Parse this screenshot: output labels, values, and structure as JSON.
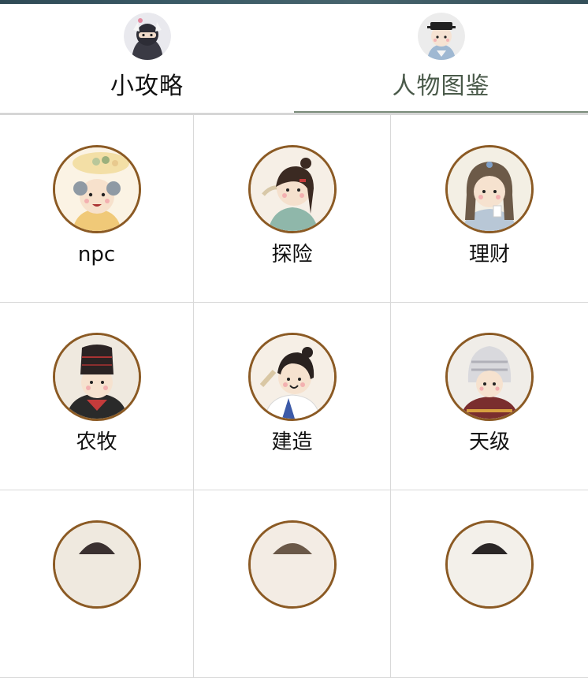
{
  "tabs": [
    {
      "label": "小攻略",
      "active": false,
      "icon": "ninja-avatar-icon"
    },
    {
      "label": "人物图鉴",
      "active": true,
      "icon": "official-avatar-icon"
    }
  ],
  "categories": [
    {
      "label": "npc",
      "icon": "elder-avatar-icon"
    },
    {
      "label": "探险",
      "icon": "adventurer-avatar-icon"
    },
    {
      "label": "理财",
      "icon": "lady-avatar-icon"
    },
    {
      "label": "农牧",
      "icon": "farmer-avatar-icon"
    },
    {
      "label": "建造",
      "icon": "builder-avatar-icon"
    },
    {
      "label": "天级",
      "icon": "ornate-headdress-avatar-icon"
    },
    {
      "label": "",
      "icon": "partial-avatar-icon"
    },
    {
      "label": "",
      "icon": "partial-avatar-icon"
    },
    {
      "label": "",
      "icon": "partial-avatar-icon"
    }
  ],
  "colors": {
    "accent": "#7a8c7a",
    "avatar_ring": "#8b5a24",
    "active_tab_text": "#4a5a4a",
    "divider": "#d9d9d9"
  }
}
